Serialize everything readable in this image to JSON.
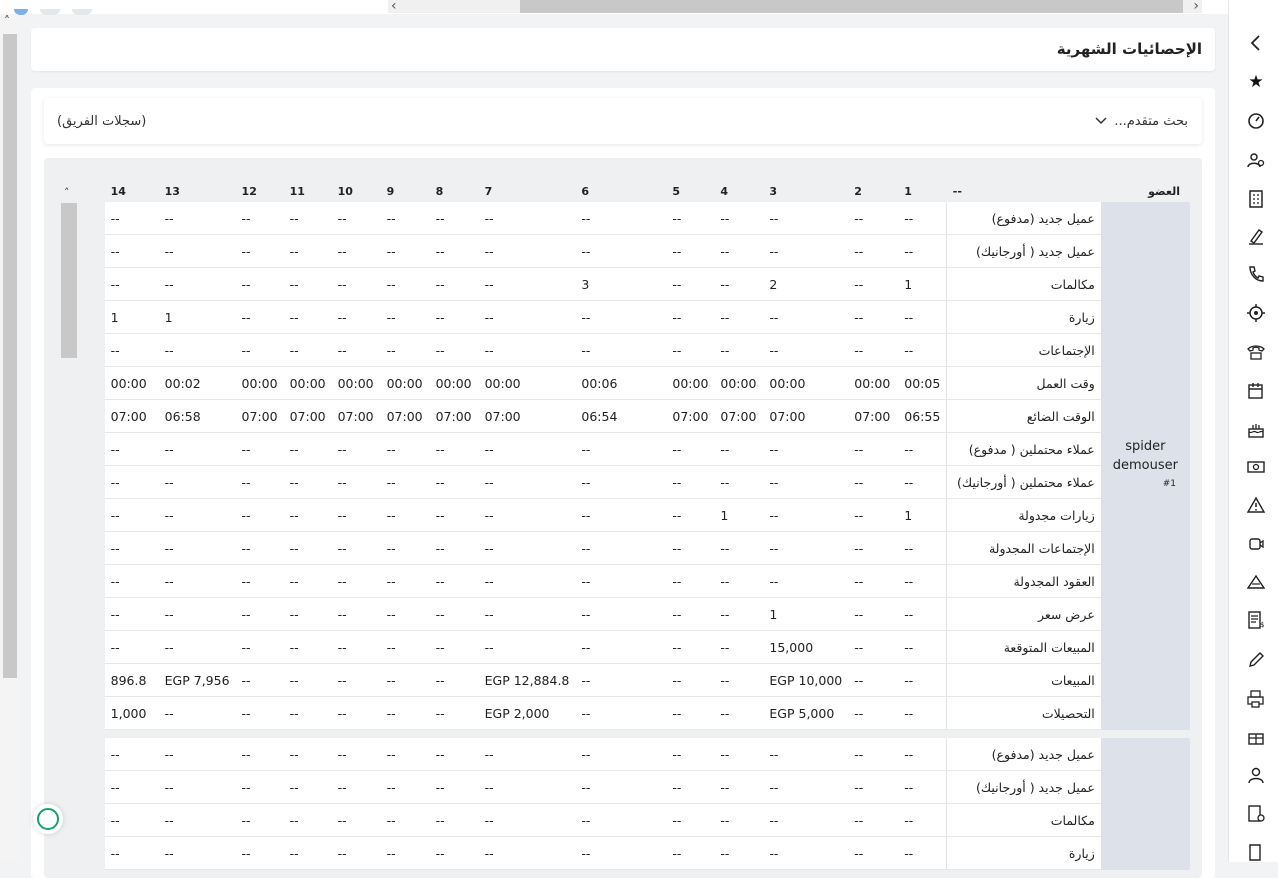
{
  "page": {
    "title": "الإحصائيات الشهرية"
  },
  "filters": {
    "advanced_search": "بحث متقدم...",
    "team_records": "(سجلات الفريق)"
  },
  "table": {
    "member_header": "العضو",
    "dash_header": "--",
    "days": [
      "1",
      "2",
      "3",
      "4",
      "5",
      "6",
      "7",
      "8",
      "9",
      "10",
      "11",
      "12",
      "13",
      "14"
    ],
    "member_name": "spider demouser",
    "member_id": "#1",
    "rows": [
      {
        "label": "عميل جديد (مدفوع)",
        "values": [
          "--",
          "--",
          "--",
          "--",
          "--",
          "--",
          "--",
          "--",
          "--",
          "--",
          "--",
          "--",
          "--",
          "--"
        ]
      },
      {
        "label": "عميل جديد ( أورجانيك)",
        "values": [
          "--",
          "--",
          "--",
          "--",
          "--",
          "--",
          "--",
          "--",
          "--",
          "--",
          "--",
          "--",
          "--",
          "--"
        ]
      },
      {
        "label": "مكالمات",
        "values": [
          "1",
          "--",
          "2",
          "--",
          "--",
          "3",
          "--",
          "--",
          "--",
          "--",
          "--",
          "--",
          "--",
          "--"
        ]
      },
      {
        "label": "زيارة",
        "values": [
          "--",
          "--",
          "--",
          "--",
          "--",
          "--",
          "--",
          "--",
          "--",
          "--",
          "--",
          "--",
          "1",
          "1"
        ]
      },
      {
        "label": "الإجتماعات",
        "values": [
          "--",
          "--",
          "--",
          "--",
          "--",
          "--",
          "--",
          "--",
          "--",
          "--",
          "--",
          "--",
          "--",
          "--"
        ]
      },
      {
        "label": "وقت العمل",
        "values": [
          "00:05",
          "00:00",
          "00:00",
          "00:00",
          "00:00",
          "00:06",
          "00:00",
          "00:00",
          "00:00",
          "00:00",
          "00:00",
          "00:00",
          "00:02",
          "00:00"
        ]
      },
      {
        "label": "الوقت الضائع",
        "values": [
          "06:55",
          "07:00",
          "07:00",
          "07:00",
          "07:00",
          "06:54",
          "07:00",
          "07:00",
          "07:00",
          "07:00",
          "07:00",
          "07:00",
          "06:58",
          "07:00"
        ]
      },
      {
        "label": "عملاء محتملين ( مدفوع)",
        "values": [
          "--",
          "--",
          "--",
          "--",
          "--",
          "--",
          "--",
          "--",
          "--",
          "--",
          "--",
          "--",
          "--",
          "--"
        ]
      },
      {
        "label": "عملاء محتملين ( أورجانيك)",
        "values": [
          "--",
          "--",
          "--",
          "--",
          "--",
          "--",
          "--",
          "--",
          "--",
          "--",
          "--",
          "--",
          "--",
          "--"
        ]
      },
      {
        "label": "زيارات مجدولة",
        "values": [
          "1",
          "--",
          "--",
          "1",
          "--",
          "--",
          "--",
          "--",
          "--",
          "--",
          "--",
          "--",
          "--",
          "--"
        ]
      },
      {
        "label": "الإجتماعات المجدولة",
        "values": [
          "--",
          "--",
          "--",
          "--",
          "--",
          "--",
          "--",
          "--",
          "--",
          "--",
          "--",
          "--",
          "--",
          "--"
        ]
      },
      {
        "label": "العقود المجدولة",
        "values": [
          "--",
          "--",
          "--",
          "--",
          "--",
          "--",
          "--",
          "--",
          "--",
          "--",
          "--",
          "--",
          "--",
          "--"
        ]
      },
      {
        "label": "عرض سعر",
        "values": [
          "--",
          "--",
          "1",
          "--",
          "--",
          "--",
          "--",
          "--",
          "--",
          "--",
          "--",
          "--",
          "--",
          "--"
        ]
      },
      {
        "label": "المبيعات المتوقعة",
        "values": [
          "--",
          "--",
          "15,000",
          "--",
          "--",
          "--",
          "--",
          "--",
          "--",
          "--",
          "--",
          "--",
          "--",
          "--"
        ]
      },
      {
        "label": "المبيعات",
        "values": [
          "--",
          "--",
          "EGP 10,000",
          "--",
          "--",
          "--",
          "EGP 12,884.8",
          "--",
          "--",
          "--",
          "--",
          "--",
          "EGP 7,956",
          "896.8"
        ]
      },
      {
        "label": "التحصيلات",
        "values": [
          "--",
          "--",
          "EGP 5,000",
          "--",
          "--",
          "--",
          "EGP 2,000",
          "--",
          "--",
          "--",
          "--",
          "--",
          "--",
          "1,000"
        ]
      }
    ],
    "second_rows": [
      {
        "label": "عميل جديد (مدفوع)",
        "values": [
          "--",
          "--",
          "--",
          "--",
          "--",
          "--",
          "--",
          "--",
          "--",
          "--",
          "--",
          "--",
          "--",
          "--"
        ]
      },
      {
        "label": "عميل جديد ( أورجانيك)",
        "values": [
          "--",
          "--",
          "--",
          "--",
          "--",
          "--",
          "--",
          "--",
          "--",
          "--",
          "--",
          "--",
          "--",
          "--"
        ]
      },
      {
        "label": "مكالمات",
        "values": [
          "--",
          "--",
          "--",
          "--",
          "--",
          "--",
          "--",
          "--",
          "--",
          "--",
          "--",
          "--",
          "--",
          "--"
        ]
      },
      {
        "label": "زيارة",
        "values": [
          "--",
          "--",
          "--",
          "--",
          "--",
          "--",
          "--",
          "--",
          "--",
          "--",
          "--",
          "--",
          "--",
          "--"
        ]
      }
    ]
  },
  "icons": [
    "chevron-left-icon",
    "star-icon",
    "dashboard-icon",
    "users-icon",
    "building-icon",
    "pen-signature-icon",
    "phone-icon",
    "target-icon",
    "telephone-icon",
    "calendar-icon",
    "cake-icon",
    "money-icon",
    "warning-icon",
    "video-icon",
    "triangle-icon",
    "invoice-icon",
    "edit-icon",
    "print-icon",
    "gift-icon",
    "user-icon",
    "report-icon",
    "book-icon"
  ],
  "colors": {
    "accent": "#1f9d6b",
    "member_cell": "#dde2ea",
    "scrollbar": "#c8c8c8"
  }
}
